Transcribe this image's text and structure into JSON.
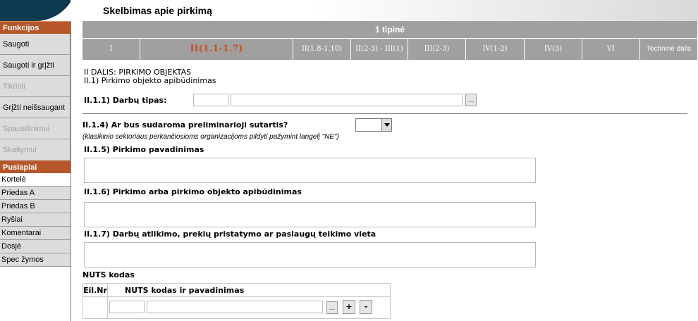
{
  "header": {
    "title": "Skelbimas apie pirkimą"
  },
  "sidebar": {
    "functions_title": "Funkcijos",
    "functions": [
      {
        "label": "Saugoti",
        "enabled": true
      },
      {
        "label": "Saugoti ir grįžti",
        "enabled": true
      },
      {
        "label": "Tikrinti",
        "enabled": false
      },
      {
        "label": "Grįžti neišsaugant",
        "enabled": true
      },
      {
        "label": "Spausdinimui",
        "enabled": false
      },
      {
        "label": "Skaitymui",
        "enabled": false
      }
    ],
    "pages_title": "Puslapiai",
    "pages": [
      {
        "label": "Kortelė",
        "active": true
      },
      {
        "label": "Priedas A"
      },
      {
        "label": "Priedas B"
      },
      {
        "label": "Ryšiai"
      },
      {
        "label": "Komentarai"
      },
      {
        "label": "Dosjė"
      },
      {
        "label": "Spec žymos"
      }
    ]
  },
  "type_bar": {
    "label": "1 tipinė"
  },
  "tabs": [
    {
      "label": "I"
    },
    {
      "label": "II(1.1-1.7)",
      "active": true
    },
    {
      "label": "II(1.8-1.10)"
    },
    {
      "label": "II(2-3) - III(1)"
    },
    {
      "label": "III(2-3)"
    },
    {
      "label": "IV(1-2)"
    },
    {
      "label": "IV(3)"
    },
    {
      "label": "VI"
    },
    {
      "label": "Techninė dalis"
    }
  ],
  "form": {
    "part_title": "II DALIS: PIRKIMO OBJEKTAS",
    "section_title": "II.1) Pirkimo objekto apibūdinimas",
    "work_type_label": "II.1.1) Darbų tipas:",
    "work_type_code": "",
    "work_type_name": "",
    "dots_label": "...",
    "prelim_label": "II.1.4) Ar bus sudaroma preliminarioji sutartis?",
    "prelim_value": "",
    "prelim_note": "(klasikinio sektoriaus perkančiosioms organizacijoms pildyti pažymint langelį \"NE\")",
    "name_label": "II.1.5) Pirkimo pavadinimas",
    "name_value": "",
    "desc_label": "II.1.6) Pirkimo arba pirkimo objekto apibūdinimas",
    "desc_value": "",
    "place_label": "II.1.7) Darbų atlikimo, prekių pristatymo ar paslaugų teikimo vieta",
    "place_value": "",
    "nuts_label": "NUTS kodas",
    "nuts_table": {
      "col_nr": "Eil.Nr",
      "col_code": "NUTS kodas ir pavadinimas",
      "add_label": "+",
      "remove_label": "-"
    }
  }
}
